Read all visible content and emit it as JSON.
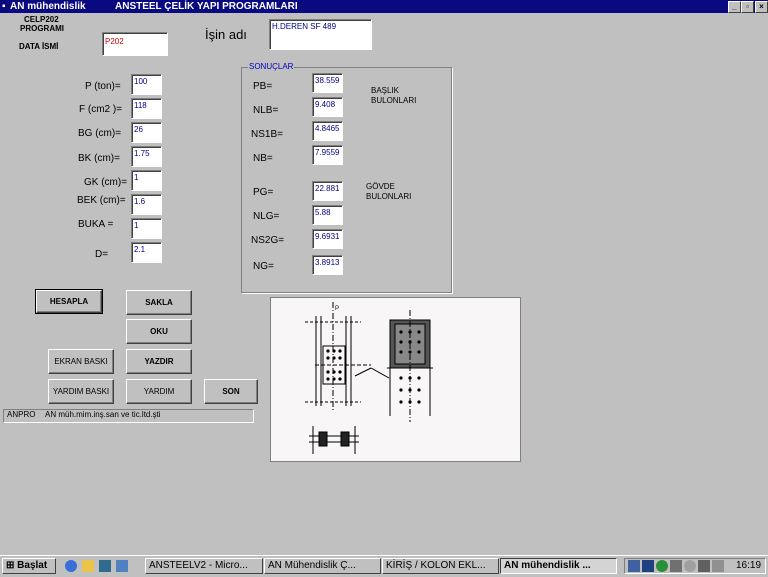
{
  "window": {
    "app_name": "AN mühendislik",
    "title": "ANSTEEL ÇELİK YAPI  PROGRAMLARI"
  },
  "header": {
    "program_line1": "CELP202",
    "program_line2": "PROGRAMI",
    "data_label": "DATA İSMİ",
    "data_value": "P202",
    "job_label": "İşin adı",
    "job_value": "H.DEREN SF 489"
  },
  "inputs": [
    {
      "label": "P (ton)=",
      "value": "100"
    },
    {
      "label": "F (cm2 )=",
      "value": "118"
    },
    {
      "label": "BG (cm)=",
      "value": "26"
    },
    {
      "label": "BK (cm)=",
      "value": "1.75"
    },
    {
      "label": "GK (cm)=",
      "value": "1"
    },
    {
      "label": "BEK (cm)=",
      "value": "1.6"
    },
    {
      "label": "BUKA =",
      "value": "1"
    },
    {
      "label": "D=",
      "value": "2.1"
    }
  ],
  "results": {
    "group_title": "SONUÇLAR",
    "rows": [
      {
        "label": "PB=",
        "value": "38.559"
      },
      {
        "label": "NLB=",
        "value": "9.408"
      },
      {
        "label": "NS1B=",
        "value": "4.8465"
      },
      {
        "label": "NB=",
        "value": "7.9559"
      },
      {
        "label": "PG=",
        "value": "22.881"
      },
      {
        "label": "NLG=",
        "value": "5.88"
      },
      {
        "label": "NS2G=",
        "value": "9.6931"
      },
      {
        "label": "NG=",
        "value": "3.8913"
      }
    ],
    "flange_note_1": "BAŞLIK",
    "flange_note_2": "BULONLARI",
    "web_note_1": "GÖVDE",
    "web_note_2": "BULONLARI"
  },
  "buttons": {
    "hesapla": "HESAPLA",
    "sakla": "SAKLA",
    "oku": "OKU",
    "ekran_baski": "EKRAN BASKI",
    "yazdir": "YAZDIR",
    "yardim_baski": "YARDIM BASKI",
    "yardim": "YARDIM",
    "son": "SON"
  },
  "status": {
    "code": "ANPRO",
    "company": "AN müh.mim.inş.san ve tic.ltd.şti"
  },
  "drawing": {
    "marker": "P"
  },
  "taskbar": {
    "start_label": "Başlat",
    "tasks": [
      "ANSTEELV2 - Micro...",
      "AN Mühendislik    Ç...",
      "KİRİŞ / KOLON EKL...",
      "AN mühendislik   ..."
    ],
    "clock": "16:19"
  },
  "colors": {
    "titlebar": "#0a0a80",
    "input_text": "#000080",
    "data_value_text": "#cc0000",
    "group_title": "#0000c0",
    "window_bg": "#c0c0c0"
  }
}
